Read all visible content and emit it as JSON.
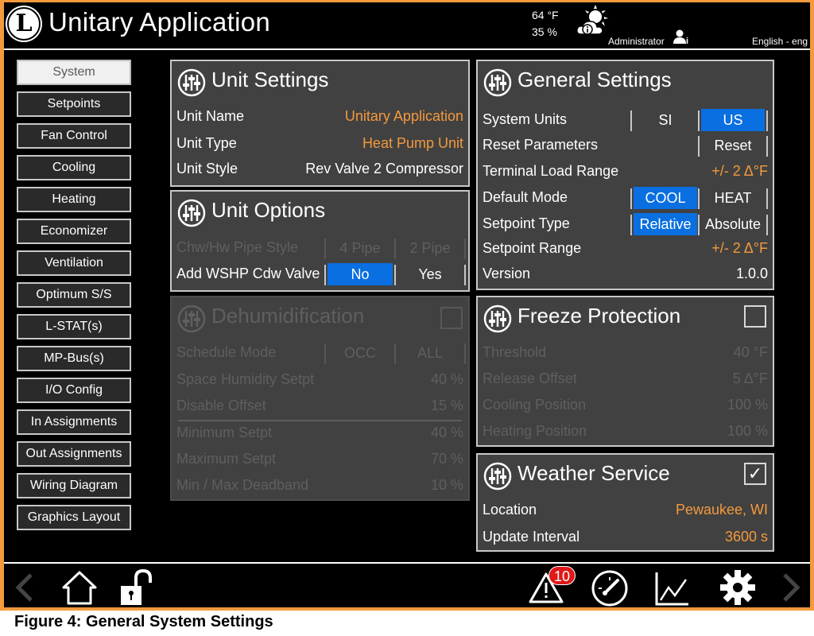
{
  "header": {
    "logo_letter": "L",
    "title": "Unitary Application",
    "temperature": "64 °F",
    "humidity": "35 %",
    "weather_icon": "partly-sunny-info-icon",
    "user": "Administrator",
    "user_icon": "user-info-icon",
    "language": "English - eng"
  },
  "sidebar": {
    "items": [
      {
        "label": "System",
        "active": true
      },
      {
        "label": "Setpoints"
      },
      {
        "label": "Fan Control"
      },
      {
        "label": "Cooling"
      },
      {
        "label": "Heating"
      },
      {
        "label": "Economizer"
      },
      {
        "label": "Ventilation"
      },
      {
        "label": "Optimum S/S"
      },
      {
        "label": "L-STAT(s)"
      },
      {
        "label": "MP-Bus(s)"
      },
      {
        "label": "I/O Config"
      },
      {
        "label": "In Assignments"
      },
      {
        "label": "Out Assignments"
      },
      {
        "label": "Wiring Diagram"
      },
      {
        "label": "Graphics Layout"
      }
    ]
  },
  "unit_settings": {
    "title": "Unit Settings",
    "rows": [
      {
        "label": "Unit Name",
        "value": "Unitary Application"
      },
      {
        "label": "Unit Type",
        "value": "Heat Pump Unit"
      },
      {
        "label": "Unit Style",
        "value": "Rev Valve 2 Compressor"
      }
    ]
  },
  "unit_options": {
    "title": "Unit Options",
    "pipe_style": {
      "label": "Chw/Hw Pipe Style",
      "opt1": "4 Pipe",
      "opt2": "2 Pipe"
    },
    "cdw_valve": {
      "label": "Add WSHP Cdw Valve",
      "opt1": "No",
      "opt2": "Yes",
      "selected": "No"
    }
  },
  "dehumidification": {
    "title": "Dehumidification",
    "enabled": false,
    "schedule_mode": {
      "label": "Schedule Mode",
      "opt1": "OCC",
      "opt2": "ALL"
    },
    "rows": [
      {
        "label": "Space Humidity Setpt",
        "value": "40 %"
      },
      {
        "label": "Disable Offset",
        "value": "15 %"
      },
      {
        "label": "Minimum Setpt",
        "value": "40 %"
      },
      {
        "label": "Maximum Setpt",
        "value": "70 %"
      },
      {
        "label": "Min / Max Deadband",
        "value": "10 %"
      }
    ]
  },
  "general_settings": {
    "title": "General Settings",
    "system_units": {
      "label": "System Units",
      "opt1": "SI",
      "opt2": "US",
      "selected": "US"
    },
    "reset_parameters": {
      "label": "Reset Parameters",
      "button": "Reset"
    },
    "terminal_load_range": {
      "label": "Terminal Load Range",
      "value": "+/- 2 Δ°F"
    },
    "default_mode": {
      "label": "Default Mode",
      "opt1": "COOL",
      "opt2": "HEAT",
      "selected": "COOL"
    },
    "setpoint_type": {
      "label": "Setpoint Type",
      "opt1": "Relative",
      "opt2": "Absolute",
      "selected": "Relative"
    },
    "setpoint_range": {
      "label": "Setpoint Range",
      "value": "+/- 2 Δ°F"
    },
    "version": {
      "label": "Version",
      "value": "1.0.0"
    }
  },
  "freeze_protection": {
    "title": "Freeze Protection",
    "enabled": false,
    "rows": [
      {
        "label": "Threshold",
        "value": "40 °F"
      },
      {
        "label": "Release Offset",
        "value": "5 Δ°F"
      },
      {
        "label": "Cooling Position",
        "value": "100 %"
      },
      {
        "label": "Heating Position",
        "value": "100 %"
      }
    ]
  },
  "weather_service": {
    "title": "Weather Service",
    "enabled": true,
    "checkmark": "✓",
    "rows": [
      {
        "label": "Location",
        "value": "Pewaukee, WI"
      },
      {
        "label": "Update Interval",
        "value": "3600 s"
      }
    ]
  },
  "footer": {
    "alarm_count": "10",
    "icons": [
      "back-arrow-icon",
      "home-icon",
      "unlock-icon",
      "alarm-icon",
      "gauge-icon",
      "trend-chart-icon",
      "settings-gear-icon",
      "forward-arrow-icon"
    ]
  },
  "caption": "Figure 4: General System Settings",
  "colors": {
    "accent": "#f39a3c",
    "selected": "#0a6fe0",
    "panel": "#414141",
    "alarm": "#e01818"
  }
}
